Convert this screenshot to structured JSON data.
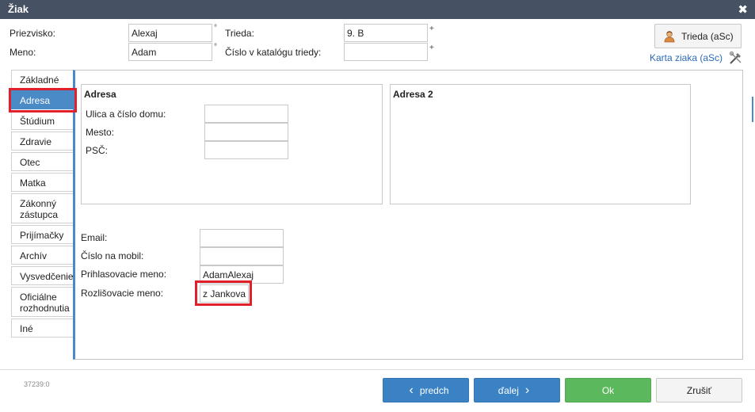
{
  "window": {
    "title": "Žiak",
    "close_icon": "✖"
  },
  "header": {
    "surname_label": "Priezvisko:",
    "surname_value": "Alexaj",
    "surname_mark": "°",
    "first_name_label": "Meno:",
    "first_name_value": "Adam",
    "first_name_mark": "°",
    "class_label": "Trieda:",
    "class_value": "9. B",
    "class_mark": "+",
    "catalog_label": "Číslo v katalógu triedy:",
    "catalog_value": "",
    "catalog_mark": "+",
    "class_button_label": "Trieda (aSc)",
    "student_card_link": "Karta ziaka (aSc)"
  },
  "tabs": [
    {
      "label": "Základné"
    },
    {
      "label": "Adresa",
      "active": true
    },
    {
      "label": "Štúdium"
    },
    {
      "label": "Zdravie"
    },
    {
      "label": "Otec"
    },
    {
      "label": "Matka"
    },
    {
      "label": "Zákonný zástupca"
    },
    {
      "label": "Prijímačky"
    },
    {
      "label": "Archív"
    },
    {
      "label": "Vysvedčenie"
    },
    {
      "label": "Oficiálne rozhodnutia"
    },
    {
      "label": "Iné"
    }
  ],
  "address": {
    "title": "Adresa",
    "street_label": "Ulica a číslo domu:",
    "street_value": "",
    "city_label": "Mesto:",
    "city_value": "",
    "zip_label": "PSČ:",
    "zip_value": ""
  },
  "address2": {
    "title": "Adresa 2"
  },
  "contact": {
    "email_label": "Email:",
    "email_value": "",
    "mobile_label": "Číslo na mobil:",
    "mobile_value": "",
    "login_label": "Prihlasovacie meno:",
    "login_value": "AdamAlexaj",
    "distinguish_label": "Rozlišovacie meno:",
    "distinguish_value": "z Jankova"
  },
  "footer": {
    "record_id": "37239:0",
    "prev_label": "predch",
    "next_label": "ďalej",
    "ok_label": "Ok",
    "cancel_label": "Zrušiť"
  },
  "colors": {
    "titlebar": "#465163",
    "accent": "#4a8ac6",
    "highlight": "#e0202a",
    "ok": "#5cb85c",
    "nav": "#3b82c4"
  }
}
